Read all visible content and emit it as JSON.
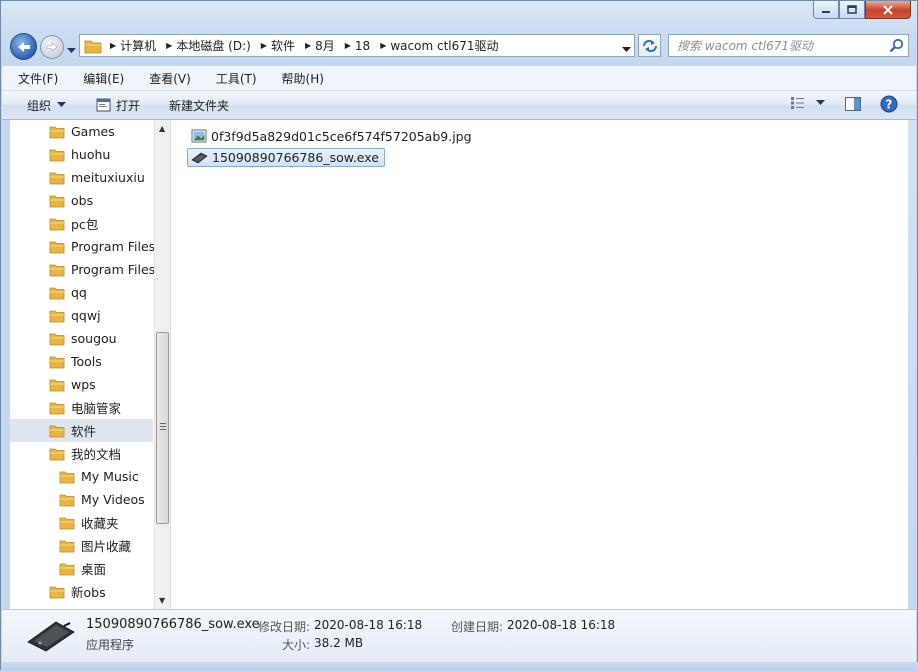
{
  "window": {
    "caption_buttons": [
      "minimize",
      "maximize",
      "close"
    ]
  },
  "address_bar": {
    "crumbs": [
      "计算机",
      "本地磁盘 (D:)",
      "软件",
      "8月",
      "18",
      "wacom ctl671驱动"
    ]
  },
  "search": {
    "placeholder": "搜索 wacom ctl671驱动"
  },
  "menu": {
    "items": [
      "文件(F)",
      "编辑(E)",
      "查看(V)",
      "工具(T)",
      "帮助(H)"
    ]
  },
  "toolbar": {
    "organize_label": "组织",
    "open_label": "打开",
    "new_folder_label": "新建文件夹"
  },
  "nav_pane": {
    "items": [
      {
        "label": "Games",
        "indent": 0
      },
      {
        "label": "huohu",
        "indent": 0
      },
      {
        "label": "meituxiuxiu",
        "indent": 0
      },
      {
        "label": "obs",
        "indent": 0
      },
      {
        "label": "pc包",
        "indent": 0
      },
      {
        "label": "Program Files",
        "indent": 0
      },
      {
        "label": "Program Files",
        "indent": 0
      },
      {
        "label": "qq",
        "indent": 0
      },
      {
        "label": "qqwj",
        "indent": 0
      },
      {
        "label": "sougou",
        "indent": 0
      },
      {
        "label": "Tools",
        "indent": 0
      },
      {
        "label": "wps",
        "indent": 0
      },
      {
        "label": "电脑管家",
        "indent": 0
      },
      {
        "label": "软件",
        "indent": 0,
        "selected": true
      },
      {
        "label": "我的文档",
        "indent": 0
      },
      {
        "label": "My Music",
        "indent": 1
      },
      {
        "label": "My Videos",
        "indent": 1
      },
      {
        "label": "收藏夹",
        "indent": 1
      },
      {
        "label": "图片收藏",
        "indent": 1
      },
      {
        "label": "桌面",
        "indent": 1
      },
      {
        "label": "新obs",
        "indent": 0
      }
    ]
  },
  "files": [
    {
      "name": "0f3f9d5a829d01c5ce6f574f57205ab9.jpg",
      "icon": "image-file-icon",
      "selected": false
    },
    {
      "name": "15090890766786_sow.exe",
      "icon": "executable-file-icon",
      "selected": true
    }
  ],
  "details": {
    "name": "15090890766786_sow.exe",
    "type": "应用程序",
    "modified_label": "修改日期:",
    "modified_value": "2020-08-18 16:18",
    "created_label": "创建日期:",
    "created_value": "2020-08-18 16:18",
    "size_label": "大小:",
    "size_value": "38.2 MB"
  },
  "colors": {
    "accent": "#2d62b5",
    "selection": "#cfe2f8",
    "folder": "#e8b640"
  }
}
